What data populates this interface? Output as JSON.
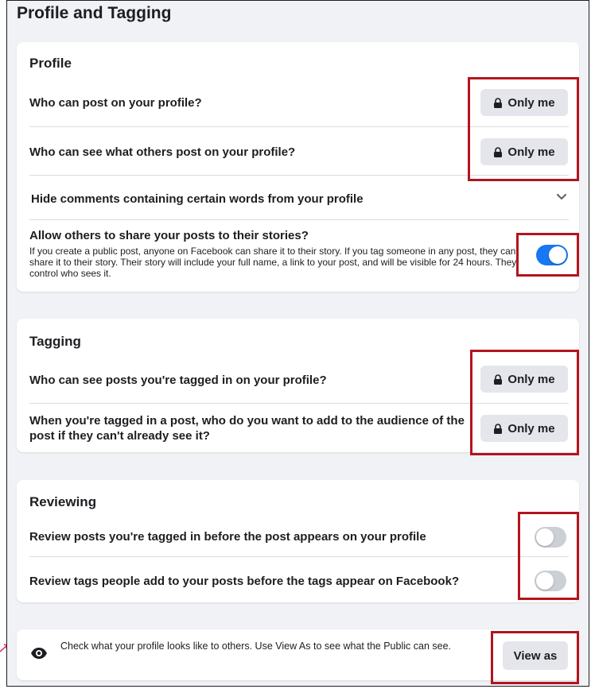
{
  "page_title": "Profile and Tagging",
  "profile": {
    "title": "Profile",
    "rows": [
      {
        "label": "Who can post on your profile?",
        "value": "Only me"
      },
      {
        "label": "Who can see what others post on your profile?",
        "value": "Only me"
      }
    ],
    "hide_comments_label": "Hide comments containing certain words from your profile",
    "share_stories": {
      "label": "Allow others to share your posts to their stories?",
      "description": "If you create a public post, anyone on Facebook can share it to their story. If you tag someone in any post, they can share it to their story. Their story will include your full name, a link to your post, and will be visible for 24 hours. They control who sees it.",
      "enabled": true
    }
  },
  "tagging": {
    "title": "Tagging",
    "rows": [
      {
        "label": "Who can see posts you're tagged in on your profile?",
        "value": "Only me"
      },
      {
        "label": "When you're tagged in a post, who do you want to add to the audience of the post if they can't already see it?",
        "value": "Only me"
      }
    ]
  },
  "reviewing": {
    "title": "Reviewing",
    "rows": [
      {
        "label": "Review posts you're tagged in before the post appears on your profile",
        "enabled": false
      },
      {
        "label": "Review tags people add to your posts before the tags appear on Facebook?",
        "enabled": false
      }
    ]
  },
  "view_as": {
    "text": "Check what your profile looks like to others. Use View As to see what the Public can see.",
    "button": "View as"
  },
  "colors": {
    "accent": "#1877f2",
    "highlight": "#b3141e",
    "annotation_arrow": "#e0245e"
  }
}
